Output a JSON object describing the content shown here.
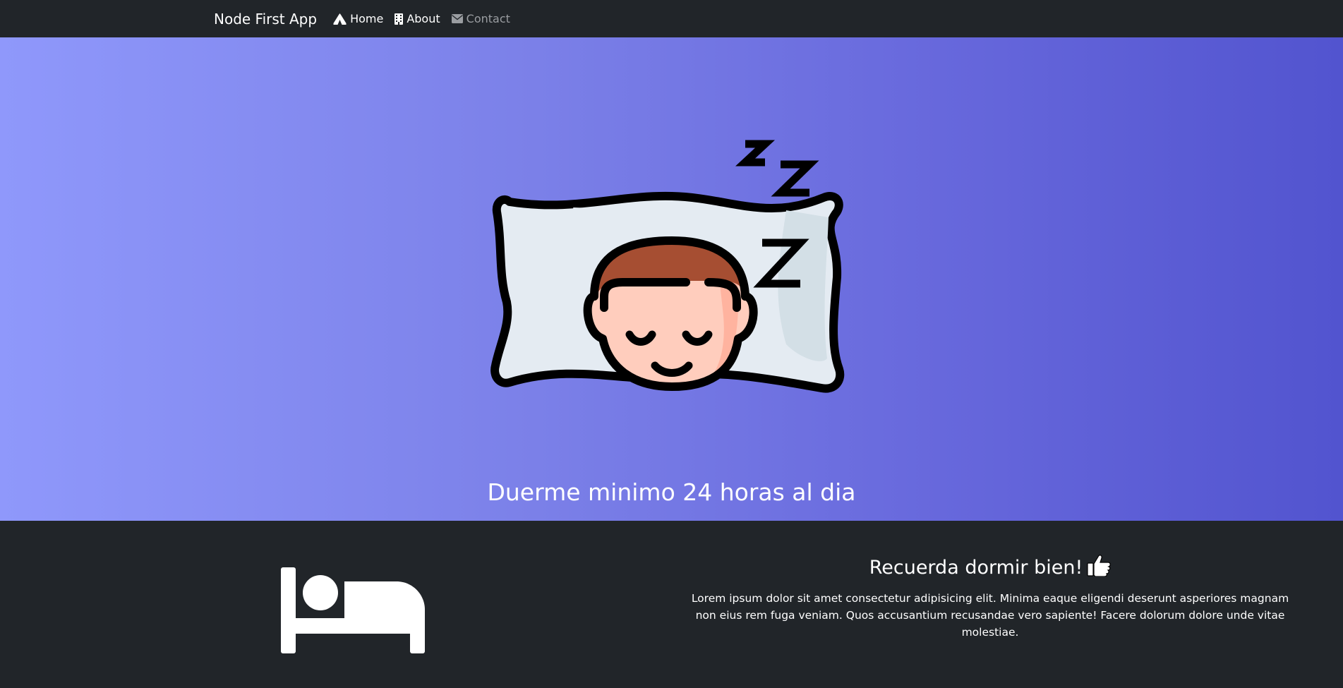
{
  "navbar": {
    "brand": "Node First App",
    "links": [
      {
        "label": "Home",
        "icon": "campground-icon"
      },
      {
        "label": "About",
        "icon": "building-icon"
      },
      {
        "label": "Contact",
        "icon": "envelope-icon"
      }
    ]
  },
  "hero": {
    "title": "Duerme minimo 24 horas al dia",
    "illustration": "sleeping-face-on-pillow"
  },
  "info": {
    "title": "Recuerda dormir bien!",
    "title_icon": "thumbs-up-icon",
    "body": "Lorem ipsum dolor sit amet consectetur adipisicing elit. Minima eaque eligendi deserunt asperiores magnam non eius rem fuga veniam. Quos accusantium recusandae vero sapiente! Facere dolorum dolore unde vitae molestiae.",
    "icon": "bed-icon"
  },
  "colors": {
    "navbar_bg": "#212529",
    "hero_gradient_start": "#8f98fb",
    "hero_gradient_end": "#5254cf",
    "muted_link": "#9a9da1"
  }
}
